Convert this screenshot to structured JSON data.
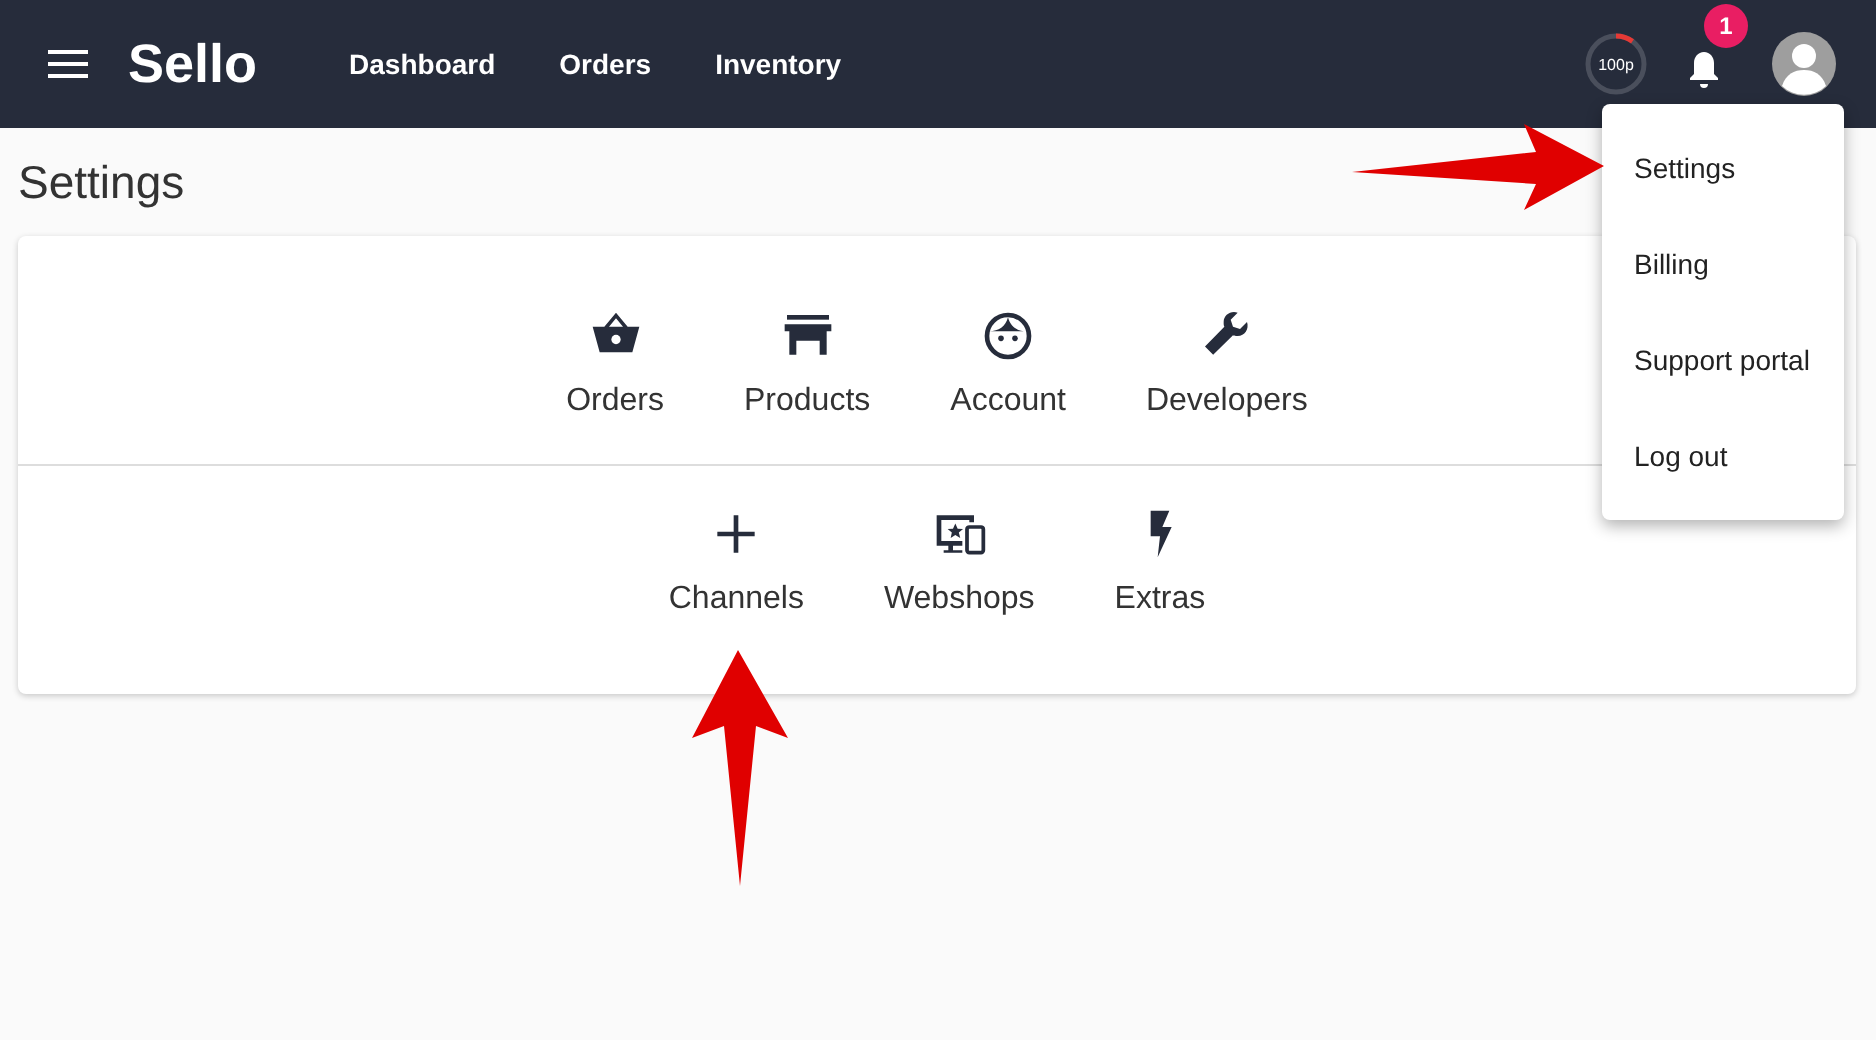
{
  "header": {
    "brand": "Sello",
    "nav": [
      {
        "label": "Dashboard"
      },
      {
        "label": "Orders"
      },
      {
        "label": "Inventory"
      }
    ],
    "quota": {
      "label": "100p",
      "level": 0.1
    },
    "notifications": {
      "count": "1"
    }
  },
  "page_title": "Settings",
  "sections": [
    {
      "tiles": [
        {
          "label": "Orders"
        },
        {
          "label": "Products"
        },
        {
          "label": "Account"
        },
        {
          "label": "Developers"
        }
      ]
    },
    {
      "tiles": [
        {
          "label": "Channels"
        },
        {
          "label": "Webshops"
        },
        {
          "label": "Extras"
        }
      ]
    }
  ],
  "user_menu": {
    "items": [
      {
        "label": "Settings"
      },
      {
        "label": "Billing"
      },
      {
        "label": "Support portal"
      },
      {
        "label": "Log out"
      }
    ]
  }
}
